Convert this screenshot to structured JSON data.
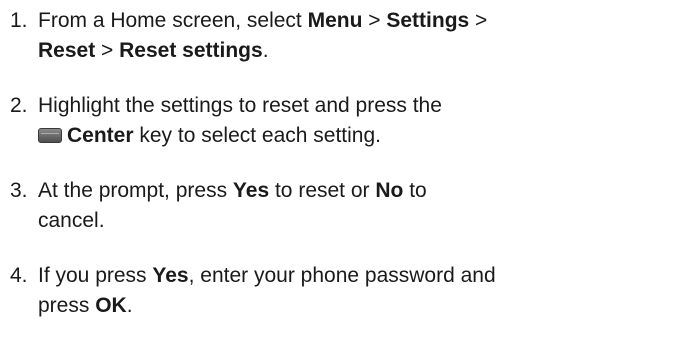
{
  "steps": [
    {
      "number": "1.",
      "line1_a": "From a Home screen, select ",
      "line1_menu": "Menu",
      "line1_gt1": " > ",
      "line1_settings": "Settings",
      "line1_gt2": " >",
      "line2_reset": "Reset",
      "line2_gt": " > ",
      "line2_reset_settings": "Reset settings",
      "line2_end": "."
    },
    {
      "number": "2.",
      "line1": "Highlight the settings to reset and press the",
      "icon": "center-key-icon",
      "line2_center": "Center",
      "line2_rest": " key to select each setting."
    },
    {
      "number": "3.",
      "line1_a": "At the prompt, press ",
      "line1_yes": "Yes",
      "line1_b": " to reset or ",
      "line1_no": "No",
      "line1_c": " to",
      "line2": "cancel."
    },
    {
      "number": "4.",
      "line1_a": "If you press ",
      "line1_yes": "Yes",
      "line1_b": ", enter your phone password and",
      "line2_a": "press ",
      "line2_ok": "OK",
      "line2_end": "."
    }
  ]
}
